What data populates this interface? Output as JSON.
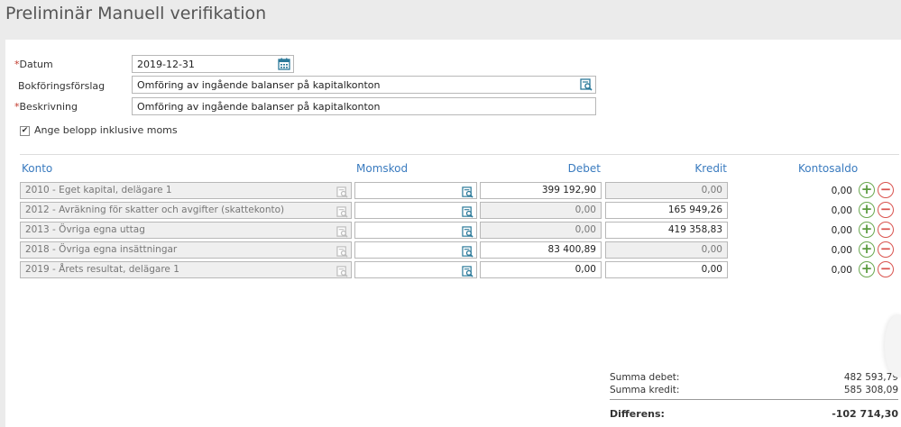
{
  "page": {
    "title": "Preliminär Manuell verifikation"
  },
  "form": {
    "datum": {
      "label": "Datum",
      "required": true,
      "value": "2019-12-31"
    },
    "bokforingsforslag": {
      "label": "Bokföringsförslag",
      "value": "Omföring av ingående balanser på kapitalkonton"
    },
    "beskrivning": {
      "label": "Beskrivning",
      "required": true,
      "value": "Omföring av ingående balanser på kapitalkonton"
    },
    "inkl_moms": {
      "label": "Ange belopp inklusive moms",
      "checked": true
    }
  },
  "table": {
    "headers": {
      "konto": "Konto",
      "momskod": "Momskod",
      "debet": "Debet",
      "kredit": "Kredit",
      "kontosaldo": "Kontosaldo"
    },
    "rows": [
      {
        "konto": "2010 - Eget kapital, delägare 1",
        "momskod": "",
        "debet": "399 192,90",
        "kredit": "0,00",
        "saldo": "0,00",
        "debet_editable": true,
        "kredit_editable": false
      },
      {
        "konto": "2012 - Avräkning för skatter och avgifter (skattekonto)",
        "momskod": "",
        "debet": "0,00",
        "kredit": "165 949,26",
        "saldo": "0,00",
        "debet_editable": false,
        "kredit_editable": true
      },
      {
        "konto": "2013 - Övriga egna uttag",
        "momskod": "",
        "debet": "0,00",
        "kredit": "419 358,83",
        "saldo": "0,00",
        "debet_editable": false,
        "kredit_editable": true
      },
      {
        "konto": "2018 - Övriga egna insättningar",
        "momskod": "",
        "debet": "83 400,89",
        "kredit": "0,00",
        "saldo": "0,00",
        "debet_editable": true,
        "kredit_editable": false
      },
      {
        "konto": "2019 - Årets resultat, delägare 1",
        "momskod": "",
        "debet": "0,00",
        "kredit": "0,00",
        "saldo": "0,00",
        "debet_editable": true,
        "kredit_editable": true
      }
    ]
  },
  "summary": {
    "summa_debet_label": "Summa debet:",
    "summa_debet": "482 593,79",
    "summa_kredit_label": "Summa kredit:",
    "summa_kredit": "585 308,09",
    "differens_label": "Differens:",
    "differens": "-102 714,30"
  },
  "icons": {
    "calendar": "calendar-icon",
    "lookup": "search-list-icon",
    "add": "plus-circle-icon",
    "remove": "minus-circle-icon"
  },
  "colors": {
    "header_blue": "#3a7bbf",
    "icon_teal": "#2c7a9a",
    "add_green": "#6aa84f",
    "remove_red": "#d9534f",
    "required_red": "#c0392b"
  }
}
